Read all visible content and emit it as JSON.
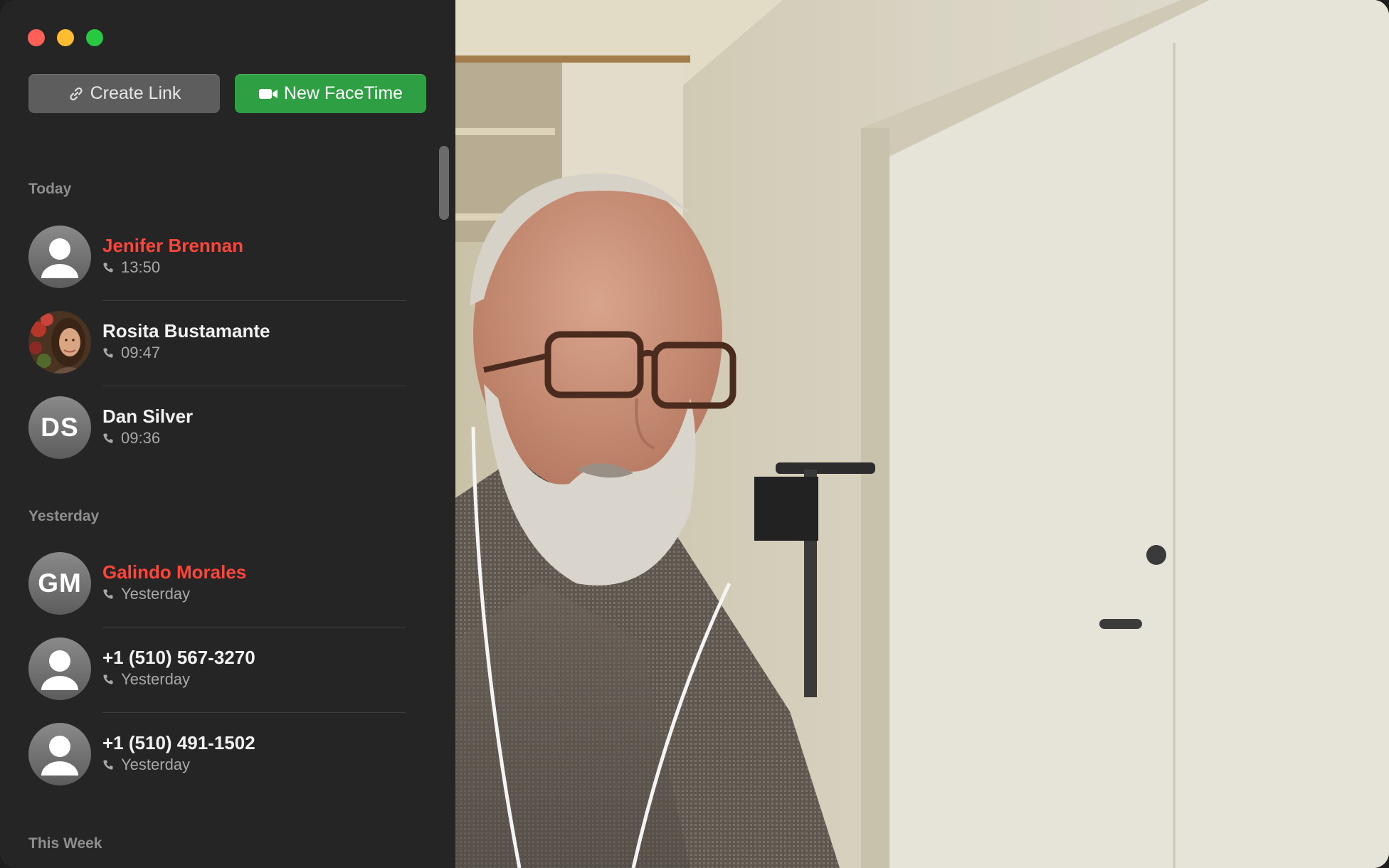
{
  "toolbar": {
    "create_link_label": "Create Link",
    "new_facetime_label": "New FaceTime"
  },
  "sections": [
    {
      "header": "Today",
      "items": [
        {
          "name": "Jenifer Brennan",
          "detail": "13:50",
          "missed": true,
          "avatar": "person"
        },
        {
          "name": "Rosita Bustamante",
          "detail": "09:47",
          "missed": false,
          "avatar": "photo"
        },
        {
          "name": "Dan Silver",
          "detail": "09:36",
          "missed": false,
          "avatar": "initials",
          "initials": "DS"
        }
      ]
    },
    {
      "header": "Yesterday",
      "items": [
        {
          "name": "Galindo Morales",
          "detail": "Yesterday",
          "missed": true,
          "avatar": "initials",
          "initials": "GM"
        },
        {
          "name": "+1 (510) 567-3270",
          "detail": "Yesterday",
          "missed": false,
          "avatar": "person"
        },
        {
          "name": "+1 (510) 491-1502",
          "detail": "Yesterday",
          "missed": false,
          "avatar": "person"
        }
      ]
    },
    {
      "header": "This Week",
      "items": []
    }
  ],
  "colors": {
    "missed": "#ff453a",
    "new_facetime": "#2ea043",
    "sidebar": "#252525"
  },
  "icons": [
    "link-icon",
    "video-camera-icon",
    "phone-icon",
    "person-placeholder-icon"
  ]
}
